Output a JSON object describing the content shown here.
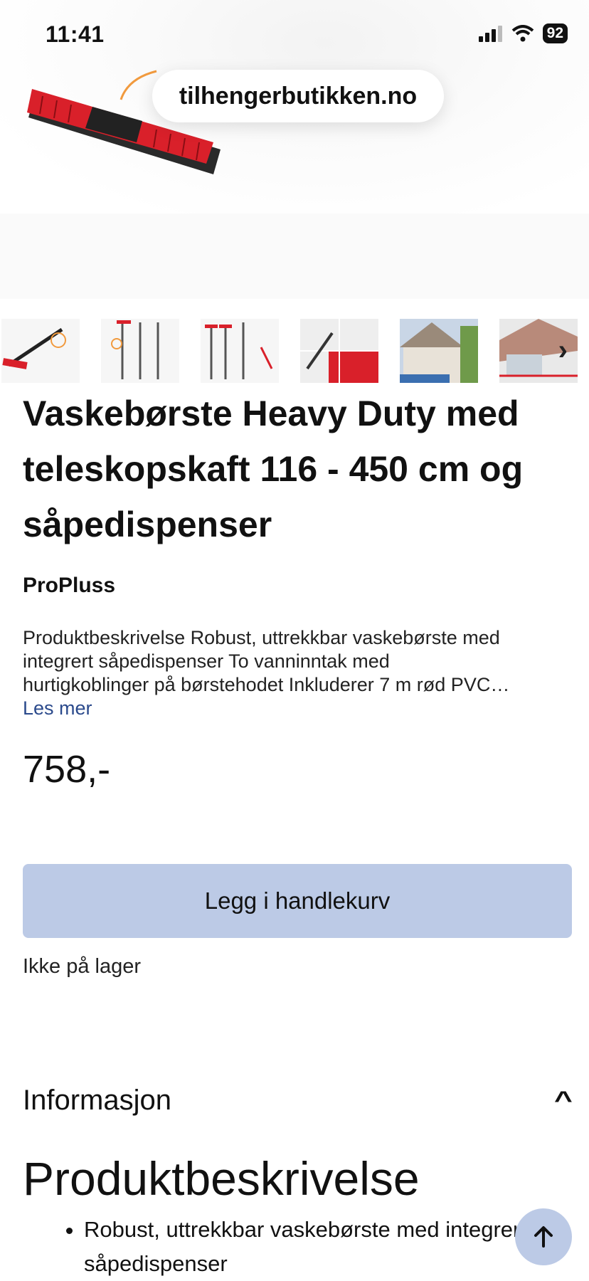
{
  "status": {
    "time": "11:41",
    "battery": "92"
  },
  "browser": {
    "url": "tilhengerbutikken.no"
  },
  "product": {
    "title": "Vaskebørste Heavy Duty med teleskopskaft 116 - 450 cm og såpedispenser",
    "brand": "ProPluss",
    "description_lines": [
      "Produktbeskrivelse Robust, uttrekkbar vaskebørste med",
      "integrert såpedispenser To vanninntak med",
      "hurtigkoblinger på børstehodet Inkluderer 7 m rød PVC…"
    ],
    "read_more": "Les mer",
    "price": "758,-",
    "add_to_cart": "Legg i handlekurv",
    "stock": "Ikke på lager"
  },
  "info": {
    "section_title": "Informasjon",
    "heading": "Produktbeskrivelse",
    "bullets": [
      "Robust, uttrekkbar vaskebørste med integrert såpedispenser"
    ]
  },
  "icons": {
    "signal": "signal-icon",
    "wifi": "wifi-icon",
    "next": "chevron-right-icon",
    "collapse": "chevron-up-icon",
    "top": "arrow-up-icon"
  },
  "colors": {
    "button": "#bccae6",
    "link": "#2b4a8c",
    "brush_red": "#d9202a"
  }
}
